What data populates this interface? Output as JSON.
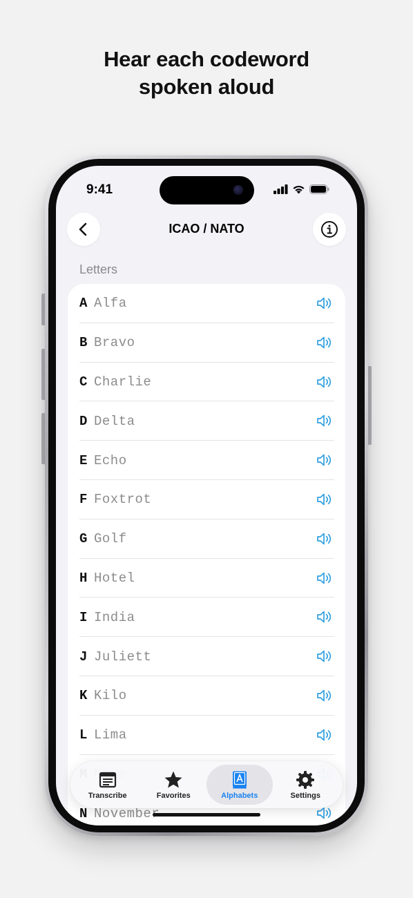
{
  "headline": {
    "line1": "Hear each codeword",
    "line2": "spoken aloud"
  },
  "status": {
    "time": "9:41"
  },
  "nav": {
    "title": "ICAO / NATO",
    "back_icon": "chevron-left-icon",
    "info_icon": "info-icon"
  },
  "section": {
    "label": "Letters"
  },
  "rows": [
    {
      "letter": "A",
      "word": "Alfa"
    },
    {
      "letter": "B",
      "word": "Bravo"
    },
    {
      "letter": "C",
      "word": "Charlie"
    },
    {
      "letter": "D",
      "word": "Delta"
    },
    {
      "letter": "E",
      "word": "Echo"
    },
    {
      "letter": "F",
      "word": "Foxtrot"
    },
    {
      "letter": "G",
      "word": "Golf"
    },
    {
      "letter": "H",
      "word": "Hotel"
    },
    {
      "letter": "I",
      "word": "India"
    },
    {
      "letter": "J",
      "word": "Juliett"
    },
    {
      "letter": "K",
      "word": "Kilo"
    },
    {
      "letter": "L",
      "word": "Lima"
    },
    {
      "letter": "M",
      "word": "Mike"
    },
    {
      "letter": "N",
      "word": "November"
    }
  ],
  "tabs": [
    {
      "label": "Transcribe",
      "icon": "transcribe-icon"
    },
    {
      "label": "Favorites",
      "icon": "star-icon"
    },
    {
      "label": "Alphabets",
      "icon": "alphabet-book-icon",
      "active": true
    },
    {
      "label": "Settings",
      "icon": "gear-icon"
    }
  ],
  "colors": {
    "accent": "#1a82f0",
    "speaker": "#2f9fe0",
    "background": "#f2f2f7"
  }
}
